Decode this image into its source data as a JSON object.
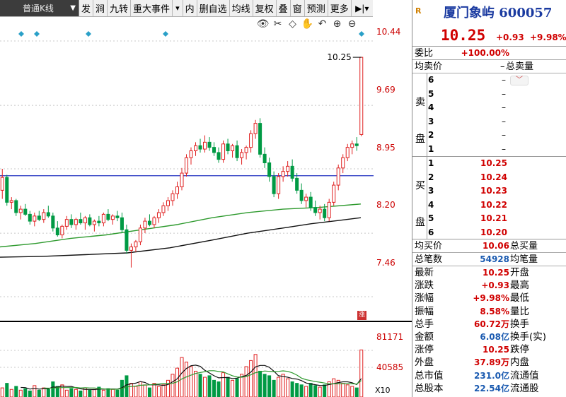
{
  "toolbar": {
    "kline_mode": "普通K线",
    "buttons": [
      "发",
      "涧",
      "九转",
      "重大事件",
      "▾",
      "内",
      "删自选",
      "均线",
      "复权",
      "叠",
      "窗",
      "预测",
      "更多"
    ],
    "end_icon": "▶|▾"
  },
  "chart_tools": [
    "👁",
    "✂",
    "◇",
    "✋",
    "↶",
    "⊕",
    "⊖"
  ],
  "axis": {
    "price_ticks": [
      "10.44",
      "9.69",
      "8.95",
      "8.20",
      "7.46"
    ],
    "volume_ticks": [
      "81171",
      "40585"
    ],
    "volume_unit": "X10",
    "zoom_badge": "涨"
  },
  "chart_data": {
    "type": "candlestick",
    "price_range": [
      7.18,
      10.72
    ],
    "last_price_label": "10.25",
    "reference_line": 8.87,
    "candles": [
      [
        8.7,
        8.95,
        8.6,
        8.85
      ],
      [
        8.85,
        8.88,
        8.52,
        8.56
      ],
      [
        8.56,
        8.62,
        8.48,
        8.58
      ],
      [
        8.58,
        8.6,
        8.4,
        8.44
      ],
      [
        8.44,
        8.52,
        8.36,
        8.48
      ],
      [
        8.48,
        8.54,
        8.4,
        8.42
      ],
      [
        8.42,
        8.46,
        8.3,
        8.34
      ],
      [
        8.34,
        8.44,
        8.28,
        8.4
      ],
      [
        8.4,
        8.46,
        8.34,
        8.36
      ],
      [
        8.36,
        8.48,
        8.32,
        8.44
      ],
      [
        8.44,
        8.52,
        8.38,
        8.4
      ],
      [
        8.4,
        8.44,
        8.22,
        8.26
      ],
      [
        8.26,
        8.34,
        8.16,
        8.18
      ],
      [
        8.18,
        8.3,
        8.14,
        8.28
      ],
      [
        8.28,
        8.4,
        8.24,
        8.36
      ],
      [
        8.36,
        8.42,
        8.26,
        8.3
      ],
      [
        8.3,
        8.38,
        8.24,
        8.36
      ],
      [
        8.36,
        8.44,
        8.3,
        8.32
      ],
      [
        8.32,
        8.4,
        8.24,
        8.38
      ],
      [
        8.38,
        8.42,
        8.28,
        8.3
      ],
      [
        8.3,
        8.36,
        8.22,
        8.34
      ],
      [
        8.34,
        8.4,
        8.28,
        8.32
      ],
      [
        8.32,
        8.44,
        8.28,
        8.42
      ],
      [
        8.42,
        8.48,
        8.34,
        8.36
      ],
      [
        8.36,
        8.42,
        8.3,
        8.4
      ],
      [
        8.4,
        8.46,
        8.34,
        8.38
      ],
      [
        8.38,
        8.44,
        8.2,
        8.24
      ],
      [
        8.24,
        8.3,
        7.96,
        8.0
      ],
      [
        8.0,
        8.08,
        7.8,
        8.04
      ],
      [
        8.04,
        8.12,
        7.98,
        8.1
      ],
      [
        8.1,
        8.3,
        8.06,
        8.26
      ],
      [
        8.26,
        8.38,
        8.2,
        8.34
      ],
      [
        8.34,
        8.42,
        8.28,
        8.3
      ],
      [
        8.3,
        8.4,
        8.26,
        8.38
      ],
      [
        8.38,
        8.48,
        8.32,
        8.44
      ],
      [
        8.44,
        8.56,
        8.4,
        8.52
      ],
      [
        8.52,
        8.62,
        8.46,
        8.58
      ],
      [
        8.58,
        8.7,
        8.52,
        8.66
      ],
      [
        8.66,
        8.8,
        8.6,
        8.74
      ],
      [
        8.74,
        8.96,
        8.7,
        8.9
      ],
      [
        8.9,
        9.12,
        8.86,
        9.08
      ],
      [
        9.08,
        9.2,
        9.0,
        9.16
      ],
      [
        9.16,
        9.26,
        9.1,
        9.22
      ],
      [
        9.22,
        9.3,
        9.14,
        9.18
      ],
      [
        9.18,
        9.34,
        9.14,
        9.26
      ],
      [
        9.26,
        9.32,
        9.16,
        9.2
      ],
      [
        9.2,
        9.26,
        9.1,
        9.14
      ],
      [
        9.14,
        9.2,
        9.02,
        9.06
      ],
      [
        9.06,
        9.28,
        9.02,
        9.24
      ],
      [
        9.24,
        9.3,
        9.12,
        9.16
      ],
      [
        9.16,
        9.24,
        9.08,
        9.22
      ],
      [
        9.22,
        9.28,
        9.04,
        9.08
      ],
      [
        9.08,
        9.18,
        9.0,
        9.14
      ],
      [
        9.14,
        9.22,
        9.06,
        9.2
      ],
      [
        9.2,
        9.4,
        9.14,
        9.36
      ],
      [
        9.36,
        9.52,
        9.3,
        9.48
      ],
      [
        9.48,
        9.54,
        9.08,
        9.12
      ],
      [
        9.12,
        9.2,
        8.96,
        9.02
      ],
      [
        9.02,
        9.08,
        8.8,
        8.86
      ],
      [
        8.86,
        8.92,
        8.62,
        8.66
      ],
      [
        8.66,
        8.9,
        8.6,
        8.86
      ],
      [
        8.86,
        8.98,
        8.8,
        8.92
      ],
      [
        8.92,
        9.04,
        8.86,
        8.98
      ],
      [
        8.98,
        9.06,
        8.8,
        8.84
      ],
      [
        8.84,
        8.9,
        8.66,
        8.7
      ],
      [
        8.7,
        8.78,
        8.54,
        8.58
      ],
      [
        8.58,
        8.66,
        8.5,
        8.62
      ],
      [
        8.62,
        8.68,
        8.46,
        8.5
      ],
      [
        8.5,
        8.58,
        8.4,
        8.44
      ],
      [
        8.44,
        8.52,
        8.36,
        8.48
      ],
      [
        8.48,
        8.54,
        8.34,
        8.38
      ],
      [
        8.38,
        8.6,
        8.34,
        8.56
      ],
      [
        8.56,
        8.8,
        8.52,
        8.76
      ],
      [
        8.76,
        9.0,
        8.7,
        8.96
      ],
      [
        8.96,
        9.12,
        8.9,
        9.08
      ],
      [
        9.08,
        9.24,
        9.04,
        9.2
      ],
      [
        9.2,
        9.28,
        9.12,
        9.24
      ],
      [
        9.24,
        9.32,
        9.16,
        9.22
      ],
      [
        9.35,
        10.25,
        9.33,
        10.25
      ]
    ],
    "ma_green": [
      [
        0,
        8.04
      ],
      [
        50,
        8.08
      ],
      [
        100,
        8.14
      ],
      [
        150,
        8.18
      ],
      [
        200,
        8.24
      ],
      [
        250,
        8.3
      ],
      [
        300,
        8.38
      ],
      [
        350,
        8.44
      ],
      [
        400,
        8.48
      ],
      [
        450,
        8.5
      ],
      [
        510,
        8.54
      ]
    ],
    "ma_black": [
      [
        0,
        7.92
      ],
      [
        60,
        7.93
      ],
      [
        120,
        7.95
      ],
      [
        180,
        7.97
      ],
      [
        240,
        8.03
      ],
      [
        300,
        8.12
      ],
      [
        350,
        8.2
      ],
      [
        400,
        8.26
      ],
      [
        440,
        8.31
      ],
      [
        480,
        8.35
      ],
      [
        510,
        8.38
      ]
    ],
    "volumes": [
      12,
      18,
      10,
      14,
      9,
      11,
      8,
      15,
      9,
      12,
      10,
      20,
      14,
      16,
      9,
      11,
      10,
      8,
      12,
      9,
      10,
      13,
      9,
      11,
      10,
      9,
      22,
      28,
      18,
      14,
      20,
      16,
      12,
      18,
      14,
      16,
      22,
      30,
      38,
      52,
      46,
      40,
      34,
      30,
      26,
      28,
      22,
      20,
      32,
      26,
      22,
      24,
      30,
      40,
      48,
      56,
      34,
      30,
      28,
      22,
      26,
      30,
      24,
      20,
      18,
      16,
      14,
      18,
      15,
      13,
      16,
      20,
      24,
      22,
      18,
      16,
      14,
      12,
      62
    ]
  },
  "stock": {
    "logo": "R",
    "name": "厦门象屿 600057",
    "price": "10.25",
    "change": "+0.93",
    "change_pct": "+9.98%"
  },
  "order_summary": {
    "weibi_label": "委比",
    "weibi_value": "+100.00%",
    "avg_sell_label": "均卖价",
    "avg_sell_value": "–",
    "total_sell_label": "总卖量",
    "avg_buy_label": "均买价",
    "avg_buy_value": "10.06",
    "total_buy_label": "总买量",
    "total_trades_label": "总笔数",
    "total_trades_value": "54928",
    "avg_trade_label": "均笔量"
  },
  "sell_book": {
    "label": "卖\n\n盘",
    "levels": [
      {
        "lv": "6",
        "price": "",
        "vol": "–"
      },
      {
        "lv": "5",
        "price": "",
        "vol": "–"
      },
      {
        "lv": "4",
        "price": "",
        "vol": "–"
      },
      {
        "lv": "3",
        "price": "",
        "vol": "–"
      },
      {
        "lv": "2",
        "price": "",
        "vol": "–"
      },
      {
        "lv": "1",
        "price": "",
        "vol": "–"
      }
    ]
  },
  "buy_book": {
    "label": "买\n\n盘",
    "levels": [
      {
        "lv": "1",
        "price": "10.25"
      },
      {
        "lv": "2",
        "price": "10.24"
      },
      {
        "lv": "3",
        "price": "10.23"
      },
      {
        "lv": "4",
        "price": "10.22"
      },
      {
        "lv": "5",
        "price": "10.21"
      },
      {
        "lv": "6",
        "price": "10.20"
      }
    ]
  },
  "stats": [
    {
      "l": "最新",
      "v": "10.25",
      "c": "red",
      "l2": "开盘"
    },
    {
      "l": "涨跌",
      "v": "+0.93",
      "c": "red",
      "l2": "最高"
    },
    {
      "l": "涨幅",
      "v": "+9.98%",
      "c": "red",
      "l2": "最低"
    },
    {
      "l": "振幅",
      "v": "8.58%",
      "c": "red",
      "l2": "量比"
    },
    {
      "l": "总手",
      "v": "60.72万",
      "c": "red",
      "l2": "换手"
    },
    {
      "l": "金额",
      "v": "6.08亿",
      "c": "blue",
      "l2": "换手(实)"
    },
    {
      "l": "涨停",
      "v": "10.25",
      "c": "red",
      "l2": "跌停"
    },
    {
      "l": "外盘",
      "v": "37.89万",
      "c": "red",
      "l2": "内盘"
    },
    {
      "l": "总市值",
      "v": "231.0亿",
      "c": "blue",
      "l2": "流通值"
    },
    {
      "l": "总股本",
      "v": "22.54亿",
      "c": "blue",
      "l2": "流通股"
    }
  ],
  "colors": {
    "up": "#e02020",
    "down": "#009a44",
    "ma_green": "#2e9a2e",
    "ma_black": "#111111",
    "ref_line": "#2030c0"
  }
}
